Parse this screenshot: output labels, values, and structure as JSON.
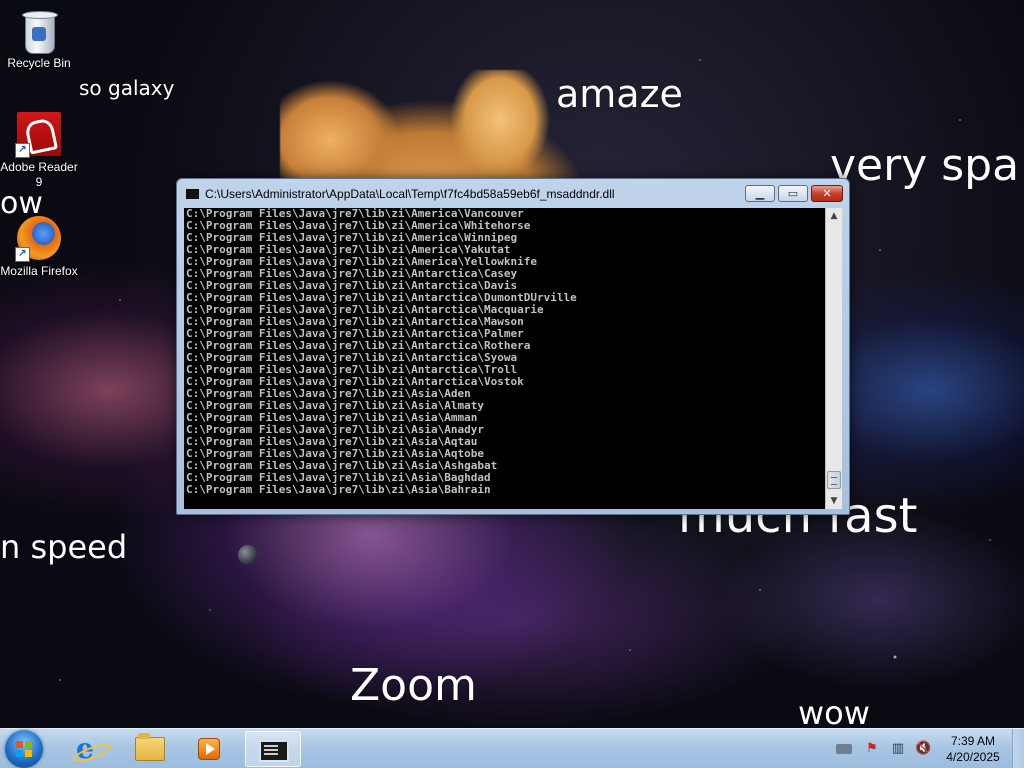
{
  "wallpaper": {
    "words": [
      "so galaxy",
      "amaze",
      "very spa",
      "ow",
      "much fast",
      "n speed",
      "Zoom",
      "wow"
    ]
  },
  "desktop_icons": [
    {
      "label": "Recycle Bin",
      "icon": "recycle-bin-icon"
    },
    {
      "label": "Adobe Reader 9",
      "icon": "adobe-reader-icon"
    },
    {
      "label": "Mozilla Firefox",
      "icon": "firefox-icon"
    }
  ],
  "console": {
    "title": "C:\\Users\\Administrator\\AppData\\Local\\Temp\\f7fc4bd58a59eb6f_msaddndr.dll",
    "buttons": {
      "minimize": "minimize-icon",
      "maximize": "maximize-icon",
      "close": "close-icon"
    },
    "lines": [
      "C:\\Program Files\\Java\\jre7\\lib\\zi\\America\\Vancouver",
      "C:\\Program Files\\Java\\jre7\\lib\\zi\\America\\Whitehorse",
      "C:\\Program Files\\Java\\jre7\\lib\\zi\\America\\Winnipeg",
      "C:\\Program Files\\Java\\jre7\\lib\\zi\\America\\Yakutat",
      "C:\\Program Files\\Java\\jre7\\lib\\zi\\America\\Yellowknife",
      "C:\\Program Files\\Java\\jre7\\lib\\zi\\Antarctica\\Casey",
      "C:\\Program Files\\Java\\jre7\\lib\\zi\\Antarctica\\Davis",
      "C:\\Program Files\\Java\\jre7\\lib\\zi\\Antarctica\\DumontDUrville",
      "C:\\Program Files\\Java\\jre7\\lib\\zi\\Antarctica\\Macquarie",
      "C:\\Program Files\\Java\\jre7\\lib\\zi\\Antarctica\\Mawson",
      "C:\\Program Files\\Java\\jre7\\lib\\zi\\Antarctica\\Palmer",
      "C:\\Program Files\\Java\\jre7\\lib\\zi\\Antarctica\\Rothera",
      "C:\\Program Files\\Java\\jre7\\lib\\zi\\Antarctica\\Syowa",
      "C:\\Program Files\\Java\\jre7\\lib\\zi\\Antarctica\\Troll",
      "C:\\Program Files\\Java\\jre7\\lib\\zi\\Antarctica\\Vostok",
      "C:\\Program Files\\Java\\jre7\\lib\\zi\\Asia\\Aden",
      "C:\\Program Files\\Java\\jre7\\lib\\zi\\Asia\\Almaty",
      "C:\\Program Files\\Java\\jre7\\lib\\zi\\Asia\\Amman",
      "C:\\Program Files\\Java\\jre7\\lib\\zi\\Asia\\Anadyr",
      "C:\\Program Files\\Java\\jre7\\lib\\zi\\Asia\\Aqtau",
      "C:\\Program Files\\Java\\jre7\\lib\\zi\\Asia\\Aqtobe",
      "C:\\Program Files\\Java\\jre7\\lib\\zi\\Asia\\Ashgabat",
      "C:\\Program Files\\Java\\jre7\\lib\\zi\\Asia\\Baghdad",
      "C:\\Program Files\\Java\\jre7\\lib\\zi\\Asia\\Bahrain"
    ]
  },
  "taskbar": {
    "pinned": [
      {
        "name": "internet-explorer",
        "icon": "ie-icon"
      },
      {
        "name": "windows-explorer",
        "icon": "folder-icon"
      },
      {
        "name": "media-player",
        "icon": "media-player-icon"
      },
      {
        "name": "console",
        "icon": "console-icon",
        "active": true
      }
    ],
    "tray": [
      "keyboard-icon",
      "action-center-flag-icon",
      "network-icon",
      "volume-muted-icon"
    ],
    "clock": {
      "time": "7:39 AM",
      "date": "4/20/2025"
    }
  },
  "colors": {
    "console_background": "#000000",
    "console_text": "#c0c0c0",
    "taskbar": "#a9c6e3",
    "close_button": "#c8412d"
  }
}
